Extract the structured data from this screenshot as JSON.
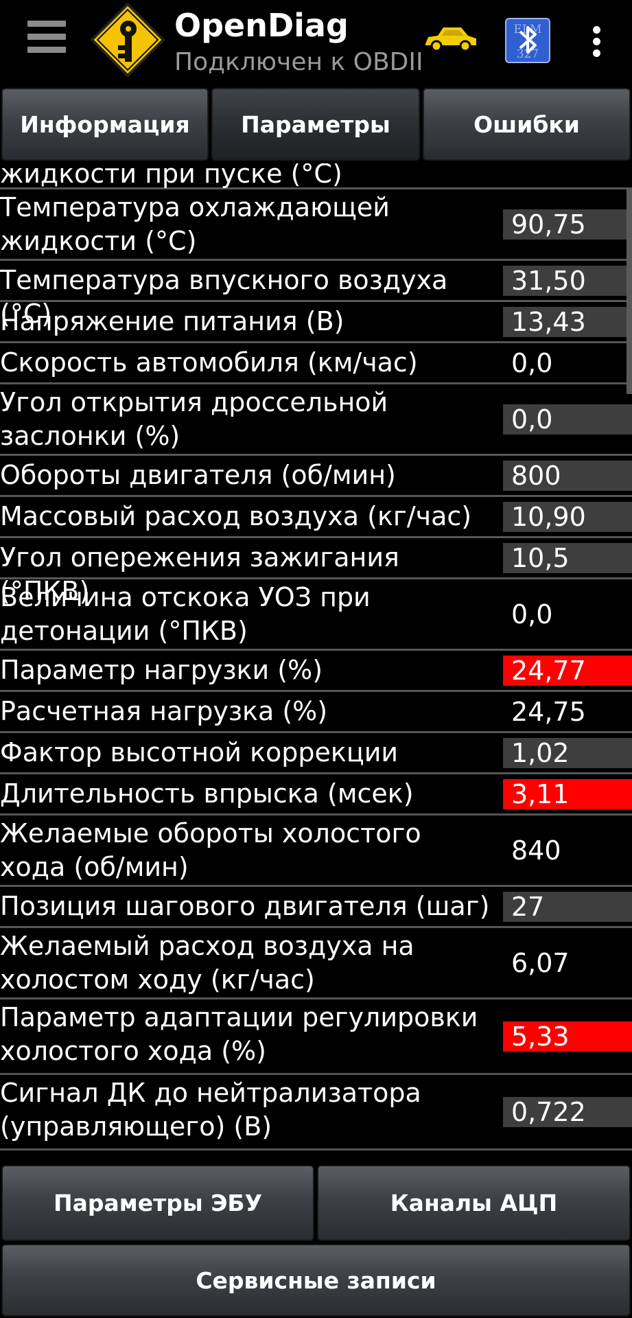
{
  "app": {
    "title": "OpenDiag",
    "subtitle": "Подключен к OBDII",
    "icons": [
      "menu-icon",
      "app-logo-icon",
      "car-icon",
      "bluetooth-elm327-icon",
      "overflow-menu-icon"
    ],
    "elm_badge": "ELM 327"
  },
  "tabs": [
    {
      "label": "Информация",
      "active": false
    },
    {
      "label": "Параметры",
      "active": true
    },
    {
      "label": "Ошибки",
      "active": false
    }
  ],
  "colors": {
    "alert": "#ff0000",
    "value_bg": "#3e3e3e",
    "background": "#000000",
    "car": "#f2cd00"
  },
  "parameters": [
    {
      "label": "Температура охлаждающей жидкости при пуске (°C)",
      "value": "",
      "state": "shaded",
      "partial": true
    },
    {
      "label": "Температура охлаждающей жидкости (°C)",
      "value": "90,75",
      "state": "shaded"
    },
    {
      "label": "Температура впускного воздуха (°C)",
      "value": "31,50",
      "state": "shaded"
    },
    {
      "label": "Напряжение питания (В)",
      "value": "13,43",
      "state": "shaded"
    },
    {
      "label": "Скорость автомобиля (км/час)",
      "value": "0,0",
      "state": "plain"
    },
    {
      "label": "Угол открытия дроссельной заслонки (%)",
      "value": "0,0",
      "state": "shaded"
    },
    {
      "label": "Обороты двигателя (об/мин)",
      "value": "800",
      "state": "shaded"
    },
    {
      "label": "Массовый расход воздуха (кг/час)",
      "value": "10,90",
      "state": "shaded"
    },
    {
      "label": "Угол опережения зажигания (°ПКВ)",
      "value": "10,5",
      "state": "shaded"
    },
    {
      "label": "Величина отскока УОЗ при детонации (°ПКВ)",
      "value": "0,0",
      "state": "plain"
    },
    {
      "label": "Параметр нагрузки (%)",
      "value": "24,77",
      "state": "alert"
    },
    {
      "label": "Расчетная нагрузка (%)",
      "value": "24,75",
      "state": "plain"
    },
    {
      "label": "Фактор высотной коррекции",
      "value": "1,02",
      "state": "shaded"
    },
    {
      "label": "Длительность впрыска (мсек)",
      "value": "3,11",
      "state": "alert"
    },
    {
      "label": "Желаемые обороты холостого хода (об/мин)",
      "value": "840",
      "state": "plain"
    },
    {
      "label": "Позиция шагового двигателя (шаг)",
      "value": "27",
      "state": "shaded"
    },
    {
      "label": "Желаемый расход воздуха на холостом ходу (кг/час)",
      "value": "6,07",
      "state": "plain"
    },
    {
      "label": "Параметр адаптации регулировки холостого хода (%)",
      "value": "5,33",
      "state": "alert"
    },
    {
      "label": "Сигнал ДК до нейтрализатора (управляющего) (В)",
      "value": "0,722",
      "state": "shaded"
    }
  ],
  "bottom_buttons": {
    "ecu_params": "Параметры ЭБУ",
    "adc_channels": "Каналы АЦП",
    "service_records": "Сервисные записи"
  }
}
